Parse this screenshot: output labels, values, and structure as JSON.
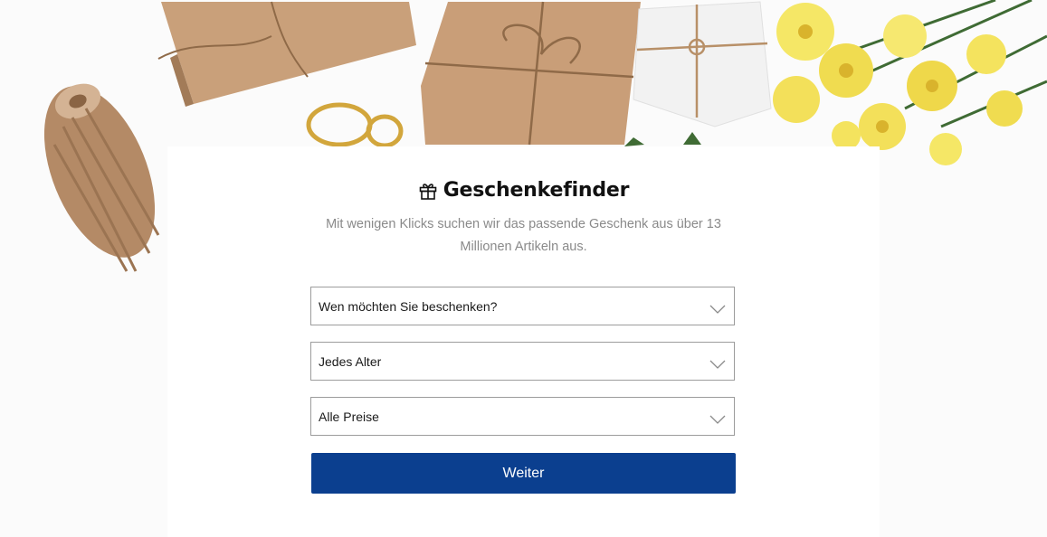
{
  "header": {
    "title": "Geschenkefinder",
    "title_icon": "gift-icon",
    "subtitle": "Mit wenigen Klicks suchen wir das passende Geschenk aus über 13 Millionen Artikeln aus."
  },
  "form": {
    "recipient_select": {
      "value": "Wen möchten Sie beschenken?",
      "icon": "chevron-down-icon"
    },
    "age_select": {
      "value": "Jedes Alter",
      "icon": "chevron-down-icon"
    },
    "price_select": {
      "value": "Alle Preise",
      "icon": "chevron-down-icon"
    },
    "submit_label": "Weiter"
  },
  "colors": {
    "button_background": "#0b3f8f",
    "subtitle_text": "#8a8a8a",
    "kraft_paper": "#c9a07a",
    "flowers": "#f3e05a"
  }
}
